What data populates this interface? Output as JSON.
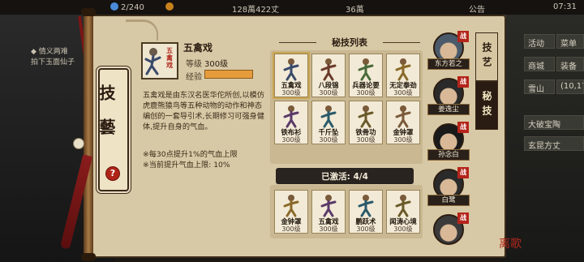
{
  "topbar": {
    "res1": "2/240",
    "res2": "128萬422丈",
    "res3": "36萬",
    "notice": "公告",
    "time": "07:31"
  },
  "background": {
    "left_text_1": "◆ 情义两难",
    "left_text_2": "拍下玉面仙子",
    "right_items": [
      "活动",
      "菜单",
      "商城",
      "装备",
      "雪山",
      "(10,17)",
      "大破宝陶",
      "玄昆方丈"
    ]
  },
  "panel": {
    "title_vertical": "技藝",
    "help": "?",
    "skill": {
      "icon_text": "五禽戏",
      "name": "五禽戏",
      "level_label": "等级",
      "level_value": "300级",
      "exp_label": "经验",
      "exp_fill": 1.0,
      "description": "五禽戏是由东汉名医华佗所创,以模仿虎鹿熊猿鸟等五种动物的动作和神态编创的一套导引术,长期修习可强身健体,提升自身的气血。",
      "bonus_1": "※每30点提升1%的气血上限",
      "bonus_2": "※当前提升气血上限: 10%"
    },
    "list_title": "秘技列表",
    "skills": [
      {
        "name": "五禽戏",
        "level": "300级"
      },
      {
        "name": "八段锦",
        "level": "300级"
      },
      {
        "name": "兵器论要",
        "level": "300级"
      },
      {
        "name": "无定拳劲",
        "level": "300级"
      },
      {
        "name": "铁布衫",
        "level": "300级"
      },
      {
        "name": "千斤坠",
        "level": "300级"
      },
      {
        "name": "铁骨功",
        "level": "300级"
      },
      {
        "name": "金钟罩",
        "level": "300级"
      }
    ],
    "activated_label": "已激活: 4/4",
    "activated": [
      {
        "name": "金钟罩",
        "level": "300级"
      },
      {
        "name": "五禽戏",
        "level": "300级"
      },
      {
        "name": "鹏跃术",
        "level": "300级"
      },
      {
        "name": "闻涛心境",
        "level": "300级"
      }
    ]
  },
  "characters": [
    {
      "name": "东方若之",
      "seal": "战"
    },
    {
      "name": "姜逸尘",
      "seal": "战"
    },
    {
      "name": "孙念白",
      "seal": "战"
    },
    {
      "name": "白鹭",
      "seal": "战"
    },
    {
      "name": "",
      "seal": "战"
    }
  ],
  "tabs": [
    {
      "label": "技艺",
      "active": false
    },
    {
      "label": "秘技",
      "active": true
    }
  ],
  "logo": "离歌",
  "colors": {
    "accent": "#e69c3c",
    "seal": "#b4241a",
    "paper": "#d8c9a6",
    "dark": "#2a1c12"
  }
}
